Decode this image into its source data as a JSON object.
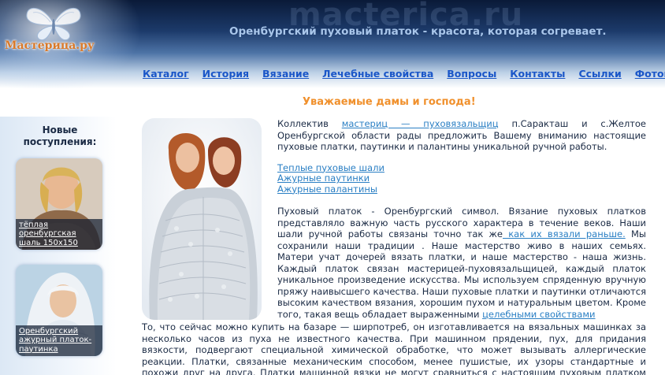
{
  "header": {
    "watermark": "macterica.ru",
    "logo_text": "Мастерица.ру",
    "slogan": "Оренбургский пуховый платок - красота, которая согревает."
  },
  "nav": {
    "items": [
      "Каталог",
      "История",
      "Вязание",
      "Лечебные свойства",
      "Вопросы",
      "Контакты",
      "Ссылки",
      "Фотогалерея"
    ]
  },
  "main": {
    "greeting": "Уважаемые дамы и господа!",
    "intro_pre": "Коллектив ",
    "intro_link": "мастериц — пуховязальщиц",
    "intro_post": " п.Саракташ и с.Желтое Оренбургской области рады предложить Вашему вниманию настоящие пуховые платки, паутинки и палантины уникальной ручной работы.",
    "product_links": [
      "Теплые пуховые шали",
      "Ажурные паутинки",
      "Ажурные палантины"
    ],
    "para2_pre": "Пуховый платок - Оренбургский символ. Вязание пуховых платков представляло важную часть русского характера в течение веков. Наши шали ручной работы связаны точно так же",
    "para2_link": " как их вязали раньше.",
    "para2_mid": " Мы сохранили наши традиции . Наше мастерство живо в наших семьях. Матери учат дочерей вязать платки, и наше мастерство - наша жизнь. Каждый платок связан мастерицей-пуховязальщицей, каждый платок уникальное произведение искусства. Мы используем спряденную вручную пряжу наивысшего качества. Наши пуховые платки и паутинки отличаются высоким качеством вязания, хорошим пухом и натуральным цветом. Кроме того, такая вещь обладает выраженными ",
    "para2_link2": "целебными свойствами",
    "bottom": "То, что сейчас можно купить на базаре — ширпотреб, он изготавливается на вязальных машинках за несколько часов из пуха не известного качества. При машинном прядении, пух, для придания вязкости, подвергают специальной химической обработке, что может вызывать аллергические реакции. Платки, связанные механическим способом, менее пушистые, их узоры стандартные и похожи друг на друга. Платки машинной вязки не могут сравниться с настоящим пуховым платком ручной работы!"
  },
  "sidebar": {
    "title": "Новые поступления:",
    "items": [
      {
        "caption": "тёплая оренбургская шаль 150x150"
      },
      {
        "caption": "Оренбургский ажурный платок-паутинка"
      }
    ]
  },
  "colors": {
    "accent_orange": "#f0902c",
    "nav_link": "#1a56c8",
    "text_link": "#2a7fc4",
    "header_dark": "#0a1a38"
  }
}
